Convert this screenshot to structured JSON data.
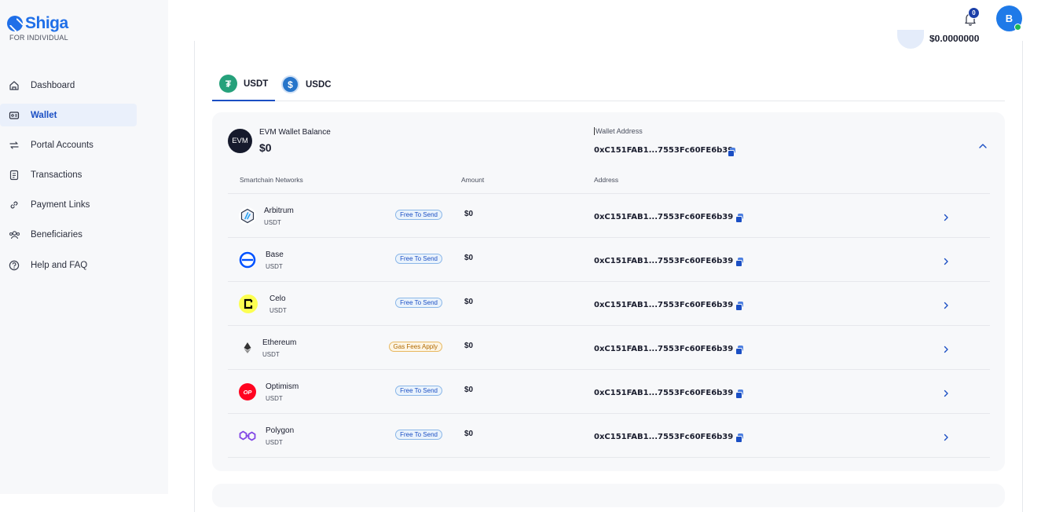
{
  "brand": {
    "name": "Shiga",
    "subtitle": "FOR INDIVIDUAL"
  },
  "sidebar": {
    "items": [
      {
        "label": "Dashboard",
        "icon": "home-icon",
        "active": false
      },
      {
        "label": "Wallet",
        "icon": "wallet-icon",
        "active": true
      },
      {
        "label": "Portal Accounts",
        "icon": "swap-icon",
        "active": false
      },
      {
        "label": "Transactions",
        "icon": "receipt-icon",
        "active": false
      },
      {
        "label": "Payment Links",
        "icon": "link-icon",
        "active": false
      },
      {
        "label": "Beneficiaries",
        "icon": "users-icon",
        "active": false
      },
      {
        "label": "Help and FAQ",
        "icon": "help-icon",
        "active": false
      }
    ]
  },
  "topbar": {
    "notification_count": "0",
    "avatar_initial": "B"
  },
  "peek": {
    "amount": "$0.0000000"
  },
  "tabs": [
    {
      "label": "USDT",
      "glyph": "₮",
      "color": "#26a17b",
      "active": true
    },
    {
      "label": "USDC",
      "glyph": "$",
      "color": "#2775ca",
      "active": false
    }
  ],
  "evm": {
    "badge": "EVM",
    "title": "EVM Wallet Balance",
    "balance": "$0",
    "wallet_address_label": "Wallet Address",
    "wallet_address": "0xC151FAB1...7553Fc60FE6b39"
  },
  "table": {
    "headers": {
      "network": "Smartchain Networks",
      "amount": "Amount",
      "address": "Address"
    },
    "rows": [
      {
        "name": "Arbitrum",
        "symbol": "USDT",
        "pill": "Free To Send",
        "pill_type": "free",
        "amount": "$0",
        "address": "0xC151FAB1...7553Fc60FE6b39",
        "icon": "arbitrum-icon"
      },
      {
        "name": "Base",
        "symbol": "USDT",
        "pill": "Free To Send",
        "pill_type": "free",
        "amount": "$0",
        "address": "0xC151FAB1...7553Fc60FE6b39",
        "icon": "base-icon"
      },
      {
        "name": "Celo",
        "symbol": "USDT",
        "pill": "Free To Send",
        "pill_type": "free",
        "amount": "$0",
        "address": "0xC151FAB1...7553Fc60FE6b39",
        "icon": "celo-icon"
      },
      {
        "name": "Ethereum",
        "symbol": "USDT",
        "pill": "Gas Fees Apply",
        "pill_type": "gas",
        "amount": "$0",
        "address": "0xC151FAB1...7553Fc60FE6b39",
        "icon": "ethereum-icon"
      },
      {
        "name": "Optimism",
        "symbol": "USDT",
        "pill": "Free To Send",
        "pill_type": "free",
        "amount": "$0",
        "address": "0xC151FAB1...7553Fc60FE6b39",
        "icon": "optimism-icon"
      },
      {
        "name": "Polygon",
        "symbol": "USDT",
        "pill": "Free To Send",
        "pill_type": "free",
        "amount": "$0",
        "address": "0xC151FAB1...7553Fc60FE6b39",
        "icon": "polygon-icon"
      }
    ]
  },
  "colors": {
    "brand": "#1f6fe8",
    "accent": "#1b4fc4",
    "card_bg": "#f7f8fa"
  }
}
